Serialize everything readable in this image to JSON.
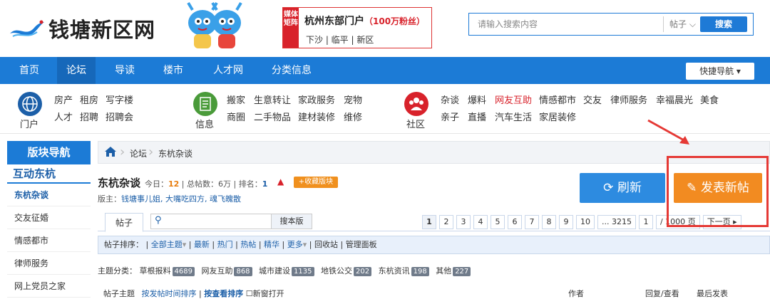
{
  "header": {
    "logo_text": "钱塘新区网",
    "ad": {
      "tag": "媒体矩阵",
      "title": "杭州东部门户",
      "fans": "（100万粉丝）",
      "sub": "下沙 | 临平 | 新区"
    },
    "search": {
      "placeholder": "请输入搜索内容",
      "type_label": "帖子",
      "button_label": "搜索"
    }
  },
  "nav": {
    "items": [
      {
        "label": "首页"
      },
      {
        "label": "论坛"
      },
      {
        "label": "导读"
      },
      {
        "label": "楼市"
      },
      {
        "label": "人才网"
      },
      {
        "label": "分类信息"
      }
    ],
    "quick_nav": "快捷导航"
  },
  "categories": [
    {
      "label": "门户",
      "color": "#1c5fa8",
      "rows": [
        [
          "房产",
          "租房",
          "写字楼"
        ],
        [
          "人才",
          "招聘",
          "招聘会"
        ]
      ]
    },
    {
      "label": "信息",
      "color": "#4a9b3a",
      "rows": [
        [
          "搬家",
          "生意转让",
          "家政服务",
          "宠物"
        ],
        [
          "商圈",
          "二手物品",
          "建材装修",
          "维修"
        ]
      ]
    },
    {
      "label": "社区",
      "color": "#d8222b",
      "rows": [
        [
          "杂谈",
          "爆料",
          "网友互助",
          "情感都市",
          "交友",
          "律师服务",
          "幸福晨光",
          "美食"
        ],
        [
          "亲子",
          "直播",
          "汽车生活",
          "家居装修"
        ]
      ],
      "highlight": "网友互助"
    }
  ],
  "sidebar": {
    "title": "版块导航",
    "group": "互动东杭",
    "items": [
      "东杭杂谈",
      "交友征婚",
      "情感都市",
      "律师服务",
      "网上党员之家"
    ]
  },
  "breadcrumb": [
    "论坛",
    "东杭杂谈"
  ],
  "forum": {
    "title": "东杭杂谈",
    "today_label": "今日：",
    "today": "12",
    "total_label": "总帖数：",
    "total": "6万",
    "rank_label": "排名：",
    "rank": "1",
    "fav_label": "+收藏版块",
    "moderators_label": "版主：",
    "moderators": "钱塘事儿姐, 大嘴吃四方, 魂飞魄散",
    "refresh_label": "刷新",
    "post_label": "发表新帖"
  },
  "tabs": {
    "posts": "帖子",
    "search_btn": "搜本版",
    "pages": [
      "1",
      "2",
      "3",
      "4",
      "5",
      "6",
      "7",
      "8",
      "9",
      "10",
      "... 3215"
    ],
    "page_input": "1",
    "page_total": "/ 1000 页",
    "next": "下一页"
  },
  "sortbar": {
    "label": "帖子排序：",
    "items": [
      "全部主题",
      "最新",
      "热门",
      "热帖",
      "精华",
      "更多",
      "回收站",
      "管理面板"
    ]
  },
  "types": {
    "label": "主题分类：",
    "items": [
      {
        "name": "草根报料",
        "count": "4689"
      },
      {
        "name": "网友互助",
        "count": "868"
      },
      {
        "name": "城市建设",
        "count": "1135"
      },
      {
        "name": "地铁公交",
        "count": "202"
      },
      {
        "name": "东杭资讯",
        "count": "198"
      },
      {
        "name": "其他",
        "count": "227"
      }
    ]
  },
  "columns": {
    "topic": "帖子主题",
    "sort_time": "按发帖时间排序",
    "sort_view": "按查看排序",
    "new_window": "新窗打开",
    "author": "作者",
    "replies": "回复/查看",
    "last": "最后发表"
  }
}
